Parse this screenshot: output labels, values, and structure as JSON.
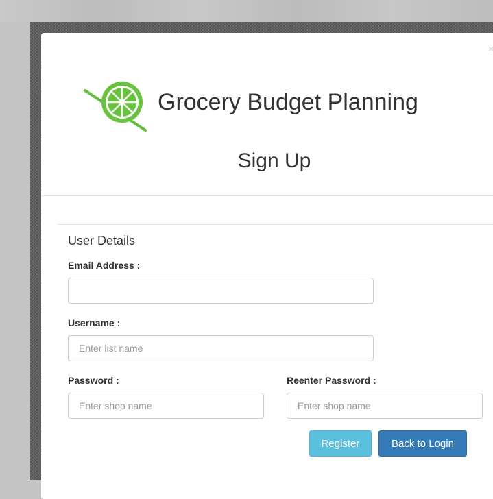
{
  "brand": {
    "title": "Grocery Budget Planning",
    "logo_icon": "lime-slice-icon",
    "accent": "#6bc63f"
  },
  "modal": {
    "close_label": "×",
    "title": "Sign Up"
  },
  "form": {
    "section_title": "User Details",
    "email": {
      "label": "Email Address :",
      "value": "",
      "placeholder": ""
    },
    "username": {
      "label": "Username :",
      "value": "",
      "placeholder": "Enter list name"
    },
    "password": {
      "label": "Password :",
      "value": "",
      "placeholder": "Enter shop name"
    },
    "reenter_password": {
      "label": "Reenter Password :",
      "value": "",
      "placeholder": "Enter shop name"
    }
  },
  "buttons": {
    "register": "Register",
    "back_to_login": "Back to Login"
  },
  "colors": {
    "register": "#5bc0de",
    "back_to_login": "#337ab7"
  }
}
